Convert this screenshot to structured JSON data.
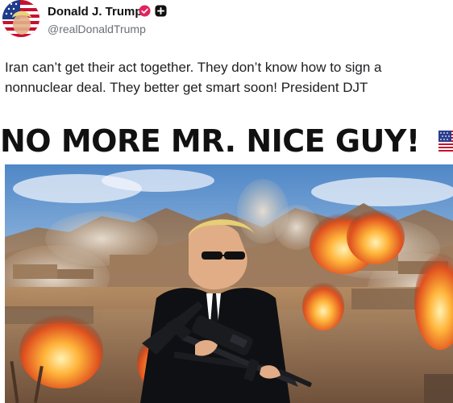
{
  "author": {
    "name": "Donald J. Trump",
    "handle": "@realDonaldTrump",
    "avatar_icon": "avatar-flag-portrait",
    "verified_icon": "verified-badge-icon",
    "plus_icon": "plus-badge-icon"
  },
  "post": {
    "text": "Iran can’t get their act together. They don’t know how to sign a nonnuclear deal. They better get smart soon! President DJT"
  },
  "media": {
    "headline": "NO MORE MR. NICE GUY!",
    "flag_icon": "us-flag-icon"
  },
  "colors": {
    "verified": "#e0245e",
    "handle": "#6b6f76",
    "text": "#202124"
  }
}
